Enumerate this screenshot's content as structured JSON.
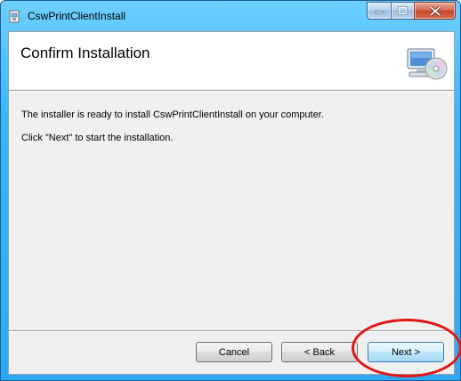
{
  "window": {
    "title": "CswPrintClientInstall",
    "controls": {
      "minimize": "minimize-icon",
      "maximize": "maximize-icon",
      "close": "close-icon"
    }
  },
  "header": {
    "title": "Confirm Installation",
    "icon": "computer-cd-icon"
  },
  "body": {
    "line1": "The installer is ready to install CswPrintClientInstall on your computer.",
    "line2": "Click \"Next\" to start the installation."
  },
  "buttons": {
    "cancel": "Cancel",
    "back": "< Back",
    "next": "Next >"
  },
  "colors": {
    "titlebar": "#3ab6ff",
    "close_button": "#c4462b",
    "client_bg": "#f0f0f0",
    "annotation": "#e01818"
  }
}
